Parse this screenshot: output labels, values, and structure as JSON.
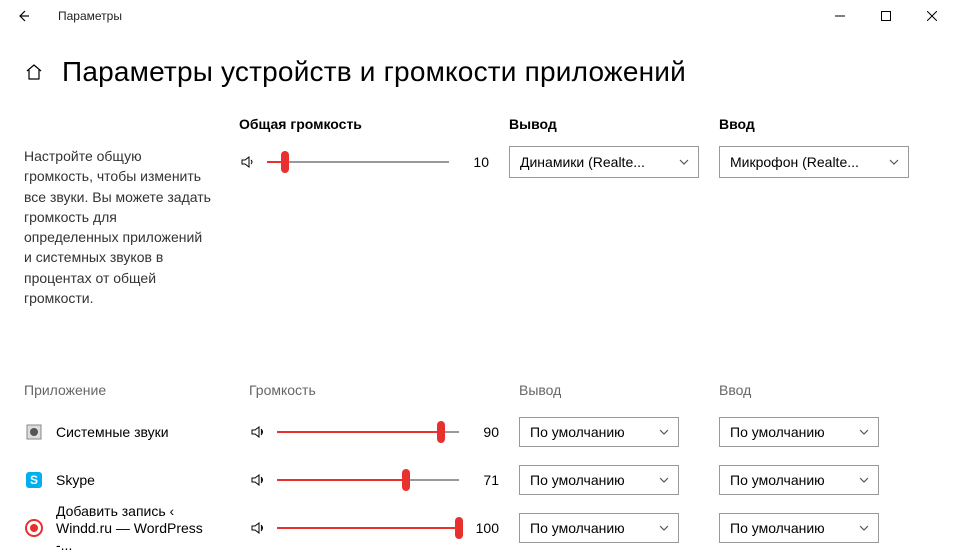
{
  "window": {
    "title": "Параметры"
  },
  "page": {
    "title": "Параметры устройств и громкости приложений",
    "description": "Настройте общую громкость, чтобы изменить все звуки. Вы можете задать громкость для определенных приложений и системных звуков в процентах от общей громкости."
  },
  "master": {
    "volume_label": "Общая громкость",
    "output_label": "Вывод",
    "input_label": "Ввод",
    "volume_value": "10",
    "volume_pct": 10,
    "output_selected": "Динамики (Realte...",
    "input_selected": "Микрофон (Realte..."
  },
  "app_section": {
    "app_header": "Приложение",
    "volume_header": "Громкость",
    "output_header": "Вывод",
    "input_header": "Ввод",
    "default_option": "По умолчанию",
    "rows": [
      {
        "name": "Системные звуки",
        "volume": "90",
        "volume_pct": 90,
        "output": "По умолчанию",
        "input": "По умолчанию"
      },
      {
        "name": "Skype",
        "volume": "71",
        "volume_pct": 71,
        "output": "По умолчанию",
        "input": "По умолчанию"
      },
      {
        "name": "Добавить запись ‹ Windd.ru — WordPress -...",
        "volume": "100",
        "volume_pct": 100,
        "output": "По умолчанию",
        "input": "По умолчанию"
      }
    ]
  },
  "colors": {
    "accent": "#e8312f"
  }
}
